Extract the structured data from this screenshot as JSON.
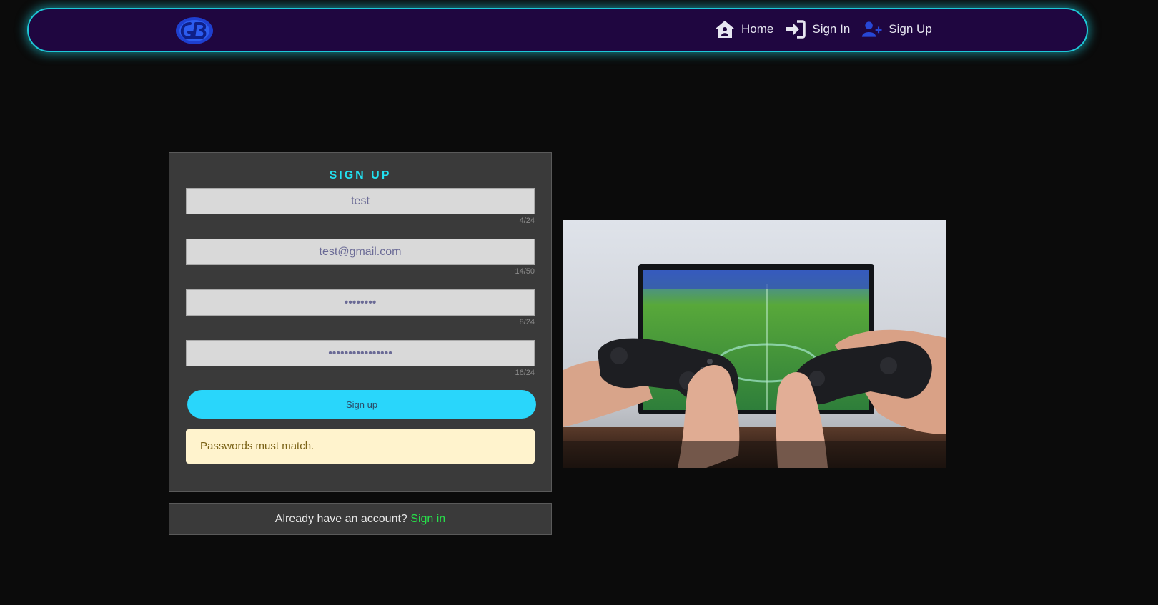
{
  "navbar": {
    "logo_icon": "gb-logo-icon",
    "items": [
      {
        "label": "Home",
        "icon": "home-icon"
      },
      {
        "label": "Sign In",
        "icon": "sign-in-icon"
      },
      {
        "label": "Sign Up",
        "icon": "user-plus-icon"
      }
    ]
  },
  "form": {
    "title": "SIGN UP",
    "fields": [
      {
        "value": "test",
        "type": "text",
        "counter": "4/24"
      },
      {
        "value": "test@gmail.com",
        "type": "email",
        "counter": "14/50"
      },
      {
        "value": "••••••••",
        "type": "password",
        "counter": "8/24"
      },
      {
        "value": "••••••••••••••••",
        "type": "password",
        "counter": "16/24"
      }
    ],
    "submit_label": "Sign up",
    "error_message": "Passwords must match."
  },
  "signin_prompt": {
    "text": "Already have an account?",
    "link": "Sign in"
  },
  "image": {
    "subject": "gaming-controllers-photo"
  },
  "colors": {
    "accent_cyan": "#22e0f0",
    "navbar_bg": "#1f0640",
    "button_bg": "#29d6fb",
    "link_green": "#27e04a",
    "alert_bg": "#fff3cd"
  }
}
